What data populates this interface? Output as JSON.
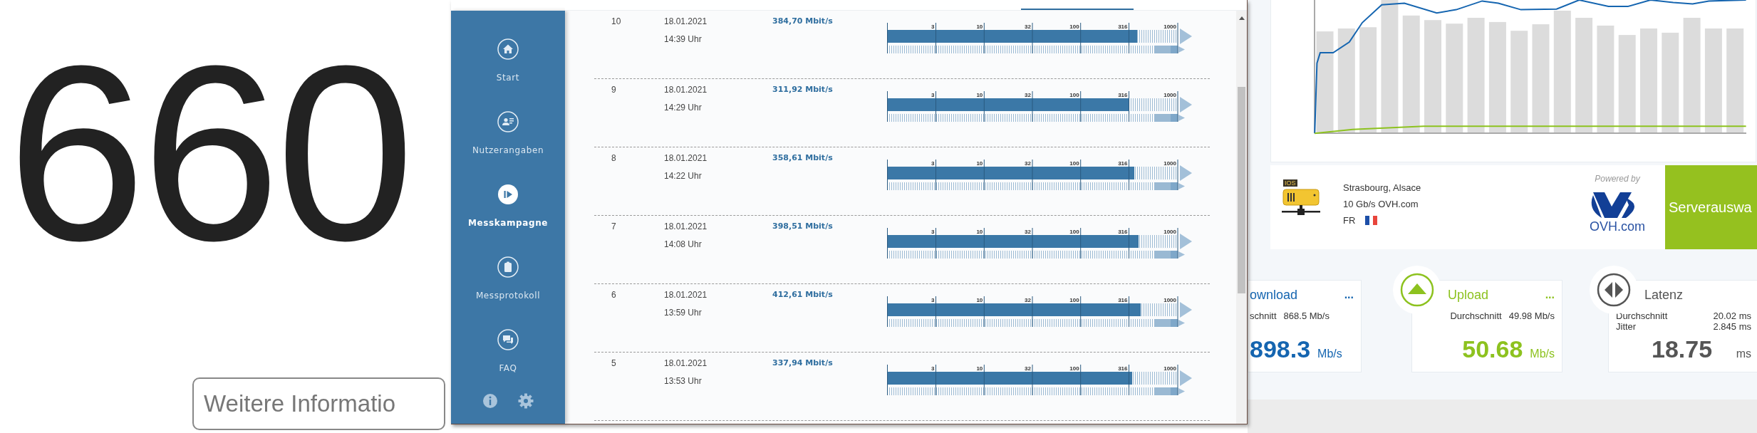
{
  "background_page": {
    "big_number": "660",
    "button": "Weitere Informatio"
  },
  "window": {
    "sidebar": {
      "items": [
        {
          "label": "Start",
          "selected": false
        },
        {
          "label": "Nutzerangaben",
          "selected": false
        },
        {
          "label": "Messkampagne",
          "selected": true
        },
        {
          "label": "Messprotokoll",
          "selected": false
        },
        {
          "label": "FAQ",
          "selected": false
        }
      ]
    },
    "rows": [
      {
        "number": "10",
        "date": "18.01.2021",
        "time": "14:39 Uhr",
        "speed": "384,70 Mbit/s",
        "level": 0.861,
        "scale_labels": [
          "3",
          "10",
          "32",
          "100",
          "316",
          "1000"
        ]
      },
      {
        "number": "9",
        "date": "18.01.2021",
        "time": "14:29 Uhr",
        "speed": "311,92 Mbit/s",
        "level": 0.833,
        "scale_labels": [
          "3",
          "10",
          "32",
          "100",
          "316",
          "1000"
        ]
      },
      {
        "number": "8",
        "date": "18.01.2021",
        "time": "14:22 Uhr",
        "speed": "358,61 Mbit/s",
        "level": 0.851,
        "scale_labels": [
          "3",
          "10",
          "32",
          "100",
          "316",
          "1000"
        ]
      },
      {
        "number": "7",
        "date": "18.01.2021",
        "time": "14:08 Uhr",
        "speed": "398,51 Mbit/s",
        "level": 0.866,
        "scale_labels": [
          "3",
          "10",
          "32",
          "100",
          "316",
          "1000"
        ]
      },
      {
        "number": "6",
        "date": "18.01.2021",
        "time": "13:59 Uhr",
        "speed": "412,61 Mbit/s",
        "level": 0.873,
        "scale_labels": [
          "3",
          "10",
          "32",
          "100",
          "316",
          "1000"
        ]
      },
      {
        "number": "5",
        "date": "18.01.2021",
        "time": "13:53 Uhr",
        "speed": "337,94 Mbit/s",
        "level": 0.842,
        "scale_labels": [
          "3",
          "10",
          "32",
          "100",
          "316",
          "1000"
        ]
      }
    ]
  },
  "right_page": {
    "server": {
      "tag": "IOS",
      "city": "Strasbourg, Alsace",
      "connection": "10 Gb/s OVH.com",
      "country": "FR",
      "powered_by": "Powered by",
      "logo_text": "OVH.com",
      "button": "Serverauswa"
    },
    "results": [
      {
        "kind": "download",
        "title": "ownload",
        "more": "...",
        "stats": [
          {
            "label": "schnitt",
            "value": "868.5 Mb/s"
          }
        ],
        "value": "898.3",
        "unit": "Mb/s"
      },
      {
        "kind": "upload",
        "title": "Upload",
        "more": "...",
        "stats": [
          {
            "label": "Durchschnitt",
            "value": "49.98 Mb/s"
          }
        ],
        "value": "50.68",
        "unit": "Mb/s"
      },
      {
        "kind": "latency",
        "title": "Latenz",
        "stats": [
          {
            "label": "Durchschnitt",
            "value": "20.02 ms"
          },
          {
            "label": "Jitter",
            "value": "2.845 ms"
          }
        ],
        "value": "18.75",
        "unit": "ms"
      }
    ]
  }
}
